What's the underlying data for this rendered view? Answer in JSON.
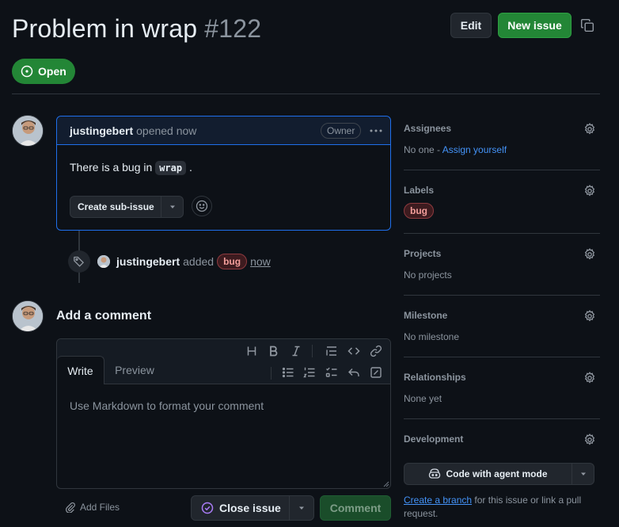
{
  "header": {
    "title": "Problem in wrap",
    "number": "#122",
    "edit_label": "Edit",
    "new_issue_label": "New issue",
    "state_label": "Open"
  },
  "comment": {
    "author": "justingebert",
    "meta": "opened now",
    "badge": "Owner",
    "body_prefix": "There is a bug in",
    "body_code": "wrap",
    "body_suffix": ".",
    "sub_issue_label": "Create sub-issue"
  },
  "event": {
    "actor": "justingebert",
    "action": "added",
    "label": "bug",
    "time": "now"
  },
  "compose": {
    "title": "Add a comment",
    "tab_write": "Write",
    "tab_preview": "Preview",
    "placeholder": "Use Markdown to format your comment",
    "add_files": "Add Files",
    "close_issue": "Close issue",
    "comment": "Comment"
  },
  "sidebar": {
    "assignees": {
      "title": "Assignees",
      "value_prefix": "No one - ",
      "value_link": "Assign yourself"
    },
    "labels": {
      "title": "Labels",
      "label": "bug"
    },
    "projects": {
      "title": "Projects",
      "value": "No projects"
    },
    "milestone": {
      "title": "Milestone",
      "value": "No milestone"
    },
    "relationships": {
      "title": "Relationships",
      "value": "None yet"
    },
    "development": {
      "title": "Development",
      "agent_button": "Code with agent mode",
      "link_text": "Create a branch",
      "rest_text": "for this issue or link a pull request."
    }
  },
  "colors": {
    "background": "#0d1117",
    "accent_green": "#238636",
    "link_blue": "#4493f8",
    "bug_label": "#f49e9b"
  },
  "icons": [
    "copy-icon",
    "issue-open-icon",
    "kebab-icon",
    "triangle-down-icon",
    "smiley-icon",
    "tag-icon",
    "heading-icon",
    "bold-icon",
    "italic-icon",
    "quote-icon",
    "code-icon",
    "link-icon",
    "unordered-list-icon",
    "ordered-list-icon",
    "tasklist-icon",
    "reply-icon",
    "fullscreen-icon",
    "paperclip-icon",
    "issue-closed-icon",
    "gear-icon",
    "copilot-icon"
  ]
}
